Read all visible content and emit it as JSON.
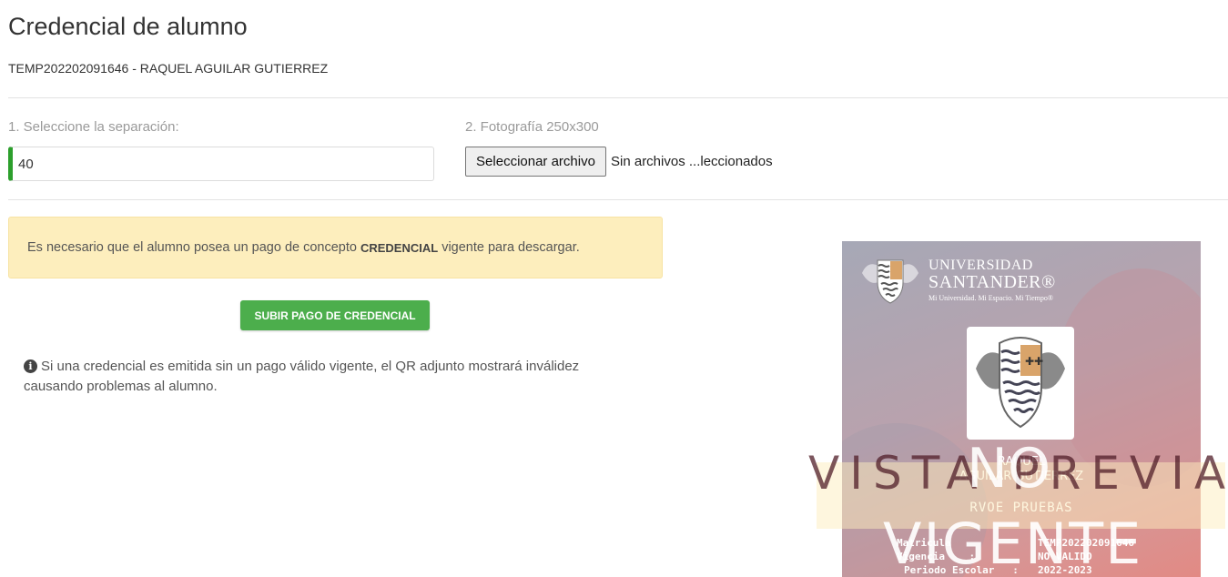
{
  "header": {
    "title": "Credencial de alumno",
    "student": "TEMP202202091646 - RAQUEL AGUILAR GUTIERREZ"
  },
  "form": {
    "separation_label": "1. Seleccione la separación:",
    "separation_value": "40",
    "photo_label": "2. Fotografía 250x300",
    "file_button": "Seleccionar archivo",
    "file_status": "Sin archivos ...leccionados"
  },
  "alert": {
    "text_before": "Es necesario que el alumno posea un pago de concepto",
    "concept": "CREDENCIAL",
    "text_after": "vigente para descargar."
  },
  "actions": {
    "upload_payment": "SUBIR PAGO DE CREDENCIAL"
  },
  "info": {
    "icon": "info-circle-icon",
    "text": "Si una credencial es emitida sin un pago válido vigente, el QR adjunto mostrará inválidez causando problemas al alumno."
  },
  "preview": {
    "university_line1": "UNIVERSIDAD",
    "university_line2": "SANTANDER®",
    "slogan": "Mi Universidad. Mi Espacio. Mi Tiempo®",
    "name_line1": "RAQUEL",
    "name_line2": "AGUILAR GUTIERREZ",
    "program": "RVOE PRUEBAS",
    "matricula_label": "Matricula",
    "matricula_value": "TEMP202202091646",
    "vigencia_label": "Vigencia    :",
    "vigencia_value": "NO VALIDO",
    "periodo_label": "Periodo Escolar   :",
    "periodo_value": "2022-2023",
    "watermark_preview": "VISTA PREVIA",
    "watermark_no": "NO",
    "watermark_vigente": "VIGENTE"
  },
  "colors": {
    "accent_green": "#4cae4c",
    "input_border_accent": "#2c9f2c",
    "alert_bg": "#fdeebd"
  }
}
